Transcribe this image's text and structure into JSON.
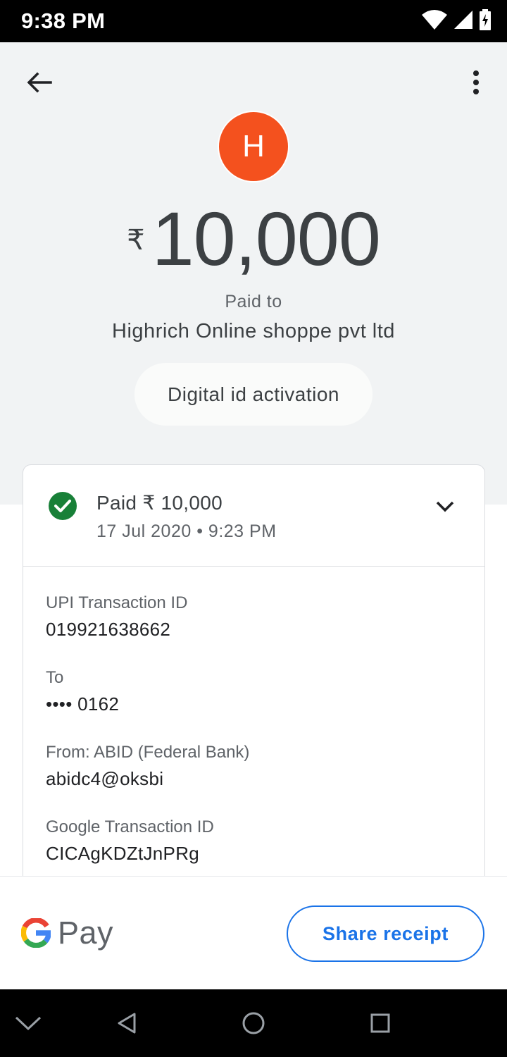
{
  "status_bar": {
    "time": "9:38 PM",
    "icons": [
      "wifi-icon",
      "cellular-signal-icon",
      "battery-charging-icon"
    ]
  },
  "toolbar": {
    "back_icon": "arrow-back-icon",
    "more_icon": "more-vert-icon"
  },
  "payee": {
    "avatar_letter": "H",
    "avatar_color": "#f4511e",
    "paid_to_label": "Paid to",
    "name": "Highrich Online shoppe pvt ltd"
  },
  "amount": {
    "currency": "₹",
    "value": "10,000"
  },
  "note": "Digital id activation",
  "transaction": {
    "status": "Paid ₹ 10,000",
    "datetime": "17 Jul 2020 • 9:23 PM",
    "status_color": "#188038",
    "details": [
      {
        "label": "UPI Transaction ID",
        "value": "019921638662"
      },
      {
        "label": "To",
        "value": "•••• 0162"
      },
      {
        "label": "From: ABID (Federal Bank)",
        "value": "abidc4@oksbi"
      },
      {
        "label": "Google Transaction ID",
        "value": "CICAgKDZtJnPRg"
      }
    ]
  },
  "footer": {
    "brand": "Pay",
    "share_label": "Share receipt",
    "accent_color": "#1a73e8"
  },
  "nav_bar": {
    "icons": [
      "chevron-down-icon",
      "back-triangle-icon",
      "home-circle-icon",
      "recents-square-icon"
    ]
  }
}
